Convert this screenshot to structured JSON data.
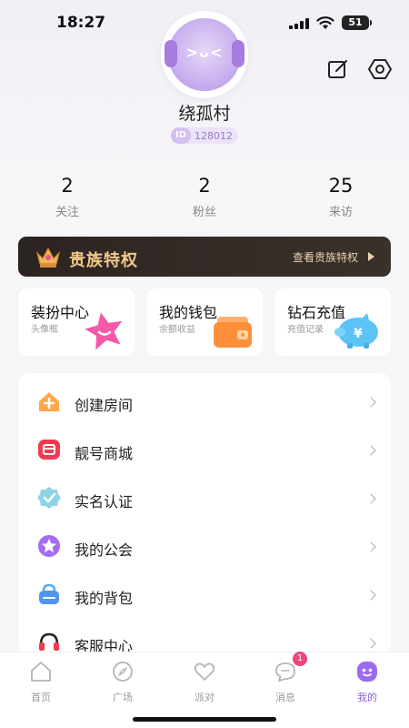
{
  "status": {
    "time": "18:27",
    "battery": "51"
  },
  "profile": {
    "name": "绕孤村",
    "id_tag": "ID",
    "id_number": "128012",
    "avatar_face": ">ᴗ<"
  },
  "stats": [
    {
      "value": "2",
      "label": "关注"
    },
    {
      "value": "2",
      "label": "粉丝"
    },
    {
      "value": "25",
      "label": "来访"
    }
  ],
  "vip": {
    "title": "贵族特权",
    "link": "查看贵族特权"
  },
  "cards": [
    {
      "title": "装扮中心",
      "subtitle": "头像框",
      "icon": "star-icon"
    },
    {
      "title": "我的钱包",
      "subtitle": "余额收益",
      "icon": "wallet-icon"
    },
    {
      "title": "钻石充值",
      "subtitle": "充值记录",
      "icon": "piggy-bank-icon"
    }
  ],
  "menu": [
    {
      "label": "创建房间",
      "icon": "house-plus-icon"
    },
    {
      "label": "靓号商城",
      "icon": "shop-icon"
    },
    {
      "label": "实名认证",
      "icon": "verified-icon"
    },
    {
      "label": "我的公会",
      "icon": "guild-star-icon"
    },
    {
      "label": "我的背包",
      "icon": "backpack-icon"
    },
    {
      "label": "客服中心",
      "icon": "headset-icon"
    }
  ],
  "tabs": [
    {
      "label": "首页",
      "icon": "home-icon"
    },
    {
      "label": "广场",
      "icon": "compass-icon"
    },
    {
      "label": "派对",
      "icon": "party-heart-icon"
    },
    {
      "label": "消息",
      "icon": "message-icon",
      "badge": "1"
    },
    {
      "label": "我的",
      "icon": "profile-icon",
      "active": true
    }
  ],
  "colors": {
    "accent": "#8c5fd9",
    "vip_gold": "#f2c98a",
    "badge": "#f0457a"
  }
}
